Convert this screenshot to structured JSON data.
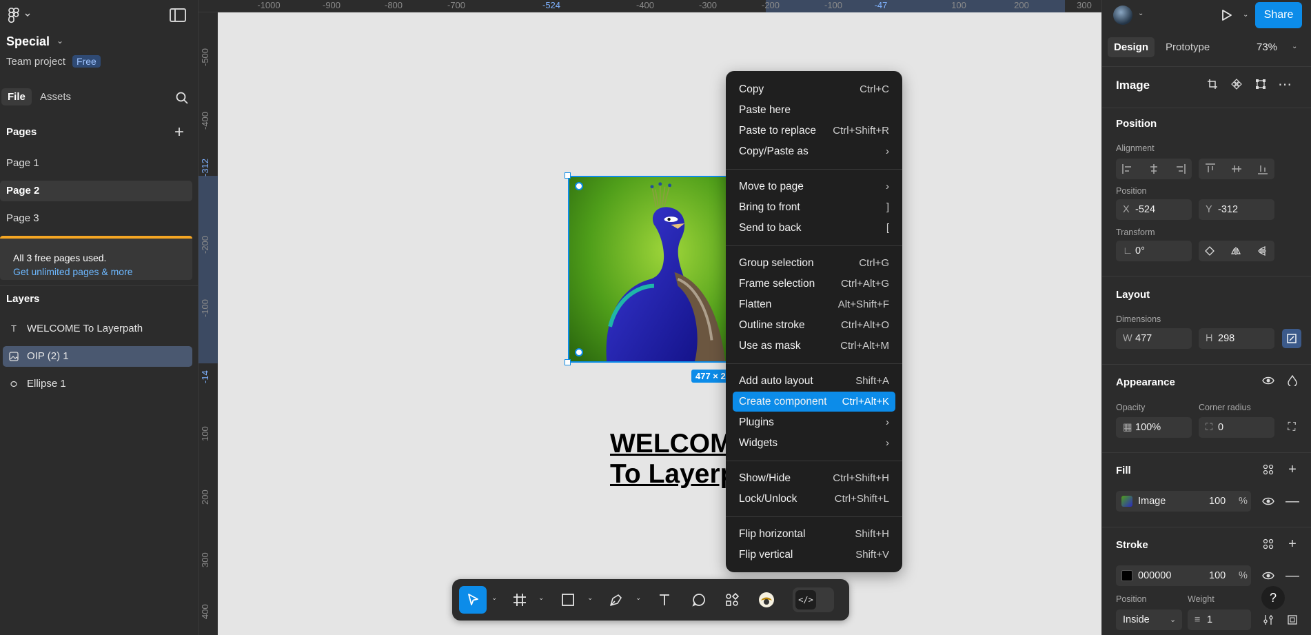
{
  "file": {
    "name": "Special",
    "team": "Team project",
    "plan_badge": "Free"
  },
  "left_tabs": {
    "file": "File",
    "assets": "Assets"
  },
  "pages": {
    "title": "Pages",
    "items": [
      "Page 1",
      "Page 2",
      "Page 3"
    ],
    "limit_text": "All 3 free pages used.",
    "limit_link": "Get unlimited pages & more"
  },
  "layers": {
    "title": "Layers",
    "items": [
      "WELCOME To Layerpath",
      "OIP (2) 1",
      "Ellipse 1"
    ]
  },
  "ruler": {
    "top": [
      "-1000",
      "-900",
      "-800",
      "-700",
      "-524",
      "-400",
      "-300",
      "-200",
      "-100",
      "-47",
      "100",
      "200",
      "300"
    ],
    "left": [
      "-500",
      "-400",
      "-312",
      "-200",
      "-100",
      "-14",
      "100",
      "200",
      "300",
      "400"
    ]
  },
  "canvas": {
    "dimension_badge": "477 × 298",
    "welcome_text": "WELCOME\nTo Layerpath"
  },
  "context_menu": {
    "groups": [
      [
        {
          "label": "Copy",
          "shortcut": "Ctrl+C"
        },
        {
          "label": "Paste here",
          "shortcut": ""
        },
        {
          "label": "Paste to replace",
          "shortcut": "Ctrl+Shift+R"
        },
        {
          "label": "Copy/Paste as",
          "shortcut": "›"
        }
      ],
      [
        {
          "label": "Move to page",
          "shortcut": "›"
        },
        {
          "label": "Bring to front",
          "shortcut": "]"
        },
        {
          "label": "Send to back",
          "shortcut": "["
        }
      ],
      [
        {
          "label": "Group selection",
          "shortcut": "Ctrl+G"
        },
        {
          "label": "Frame selection",
          "shortcut": "Ctrl+Alt+G"
        },
        {
          "label": "Flatten",
          "shortcut": "Alt+Shift+F"
        },
        {
          "label": "Outline stroke",
          "shortcut": "Ctrl+Alt+O"
        },
        {
          "label": "Use as mask",
          "shortcut": "Ctrl+Alt+M"
        }
      ],
      [
        {
          "label": "Add auto layout",
          "shortcut": "Shift+A"
        },
        {
          "label": "Create component",
          "shortcut": "Ctrl+Alt+K"
        },
        {
          "label": "Plugins",
          "shortcut": "›"
        },
        {
          "label": "Widgets",
          "shortcut": "›"
        }
      ],
      [
        {
          "label": "Show/Hide",
          "shortcut": "Ctrl+Shift+H"
        },
        {
          "label": "Lock/Unlock",
          "shortcut": "Ctrl+Shift+L"
        }
      ],
      [
        {
          "label": "Flip horizontal",
          "shortcut": "Shift+H"
        },
        {
          "label": "Flip vertical",
          "shortcut": "Shift+V"
        }
      ]
    ],
    "highlighted": "Create component"
  },
  "header": {
    "share": "Share",
    "tab_design": "Design",
    "tab_prototype": "Prototype",
    "zoom": "73%"
  },
  "inspector": {
    "element_type": "Image",
    "position": {
      "title": "Position",
      "alignment_label": "Alignment",
      "position_label": "Position",
      "x_label": "X",
      "x": "-524",
      "y_label": "Y",
      "y": "-312",
      "transform_label": "Transform",
      "rotation": "0°"
    },
    "layout": {
      "title": "Layout",
      "dimensions_label": "Dimensions",
      "w_label": "W",
      "w": "477",
      "h_label": "H",
      "h": "298"
    },
    "appearance": {
      "title": "Appearance",
      "opacity_label": "Opacity",
      "opacity": "100%",
      "radius_label": "Corner radius",
      "radius": "0"
    },
    "fill": {
      "title": "Fill",
      "type": "Image",
      "opacity": "100",
      "unit": "%"
    },
    "stroke": {
      "title": "Stroke",
      "color": "000000",
      "opacity": "100",
      "unit": "%",
      "position_label": "Position",
      "position": "Inside",
      "weight_label": "Weight",
      "weight": "1"
    }
  },
  "colors": {
    "accent": "#0c8ce9",
    "warning": "#f5a623",
    "menu_bg": "#1f1f1f"
  },
  "help": "?"
}
